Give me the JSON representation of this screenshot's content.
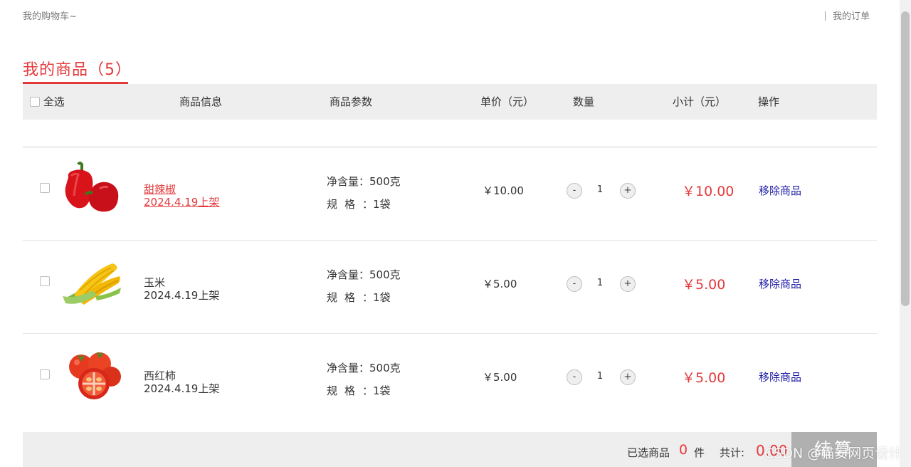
{
  "topbar": {
    "left_text": "我的购物车~",
    "orders_link": "我的订单"
  },
  "section": {
    "title": "我的商品（5）"
  },
  "table_header": {
    "select_all": "全选",
    "info": "商品信息",
    "params": "商品参数",
    "unit_price": "单价（元）",
    "quantity": "数量",
    "subtotal": "小计（元）",
    "actions": "操作"
  },
  "items": [
    {
      "name": "甜辣椒",
      "date": "2024.4.19上架",
      "param_weight": "净含量：500克",
      "param_spec_label": "规格",
      "param_spec_value": "：1袋",
      "price": "￥10.00",
      "qty": "1",
      "subtotal": "￥10.00",
      "remove": "移除商品",
      "image": "red-pepper-image"
    },
    {
      "name": "玉米",
      "date": "2024.4.19上架",
      "param_weight": "净含量：500克",
      "param_spec_label": "规格",
      "param_spec_value": "：1袋",
      "price": "￥5.00",
      "qty": "1",
      "subtotal": "￥5.00",
      "remove": "移除商品",
      "image": "corn-image"
    },
    {
      "name": "西红柿",
      "date": "2024.4.19上架",
      "param_weight": "净含量：500克",
      "param_spec_label": "规格",
      "param_spec_value": "：1袋",
      "price": "￥5.00",
      "qty": "1",
      "subtotal": "￥5.00",
      "remove": "移除商品",
      "image": "tomato-image"
    }
  ],
  "qty_controls": {
    "minus": "-",
    "plus": "+"
  },
  "footer": {
    "selected_label": "已选商品",
    "selected_count": "0",
    "selected_unit": "件",
    "total_label": "共计:",
    "total_value": "0.00",
    "checkout": "结算"
  },
  "watermark": "CSDN @猫安网页设计",
  "colors": {
    "accent": "#e4393c",
    "link": "#1a1aa6",
    "header_bg": "#eeeeee",
    "checkout_bg": "#b0b0b0"
  }
}
